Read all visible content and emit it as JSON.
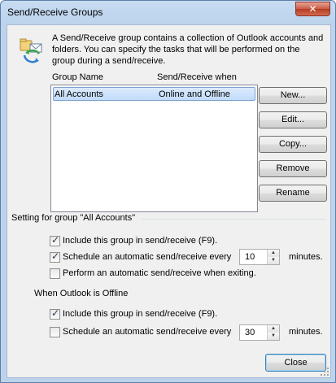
{
  "window": {
    "title": "Send/Receive Groups",
    "close_glyph": "✕"
  },
  "description": "A Send/Receive group contains a collection of Outlook accounts and folders. You can specify the tasks that will be performed on the group during a send/receive.",
  "list": {
    "columns": [
      "Group Name",
      "Send/Receive when"
    ],
    "rows": [
      {
        "name": "All Accounts",
        "when": "Online and Offline",
        "selected": true
      }
    ]
  },
  "buttons": {
    "new": "New...",
    "edit": "Edit...",
    "copy": "Copy...",
    "remove": "Remove",
    "rename": "Rename",
    "close": "Close"
  },
  "group_settings_label": "Setting for group \"All Accounts\"",
  "online": {
    "include": {
      "label": "Include this group in send/receive (F9).",
      "checked": true
    },
    "schedule": {
      "label": "Schedule an automatic send/receive every",
      "checked": true,
      "minutes": "10",
      "suffix": "minutes."
    },
    "on_exit": {
      "label": "Perform an automatic send/receive when exiting.",
      "checked": false
    }
  },
  "offline_label": "When Outlook is Offline",
  "offline": {
    "include": {
      "label": "Include this group in send/receive (F9).",
      "checked": true
    },
    "schedule": {
      "label": "Schedule an automatic send/receive every",
      "checked": false,
      "minutes": "30",
      "suffix": "minutes."
    }
  },
  "icons": {
    "group": "send-receive-group-icon",
    "check": "✓",
    "up": "▲",
    "down": "▼"
  }
}
